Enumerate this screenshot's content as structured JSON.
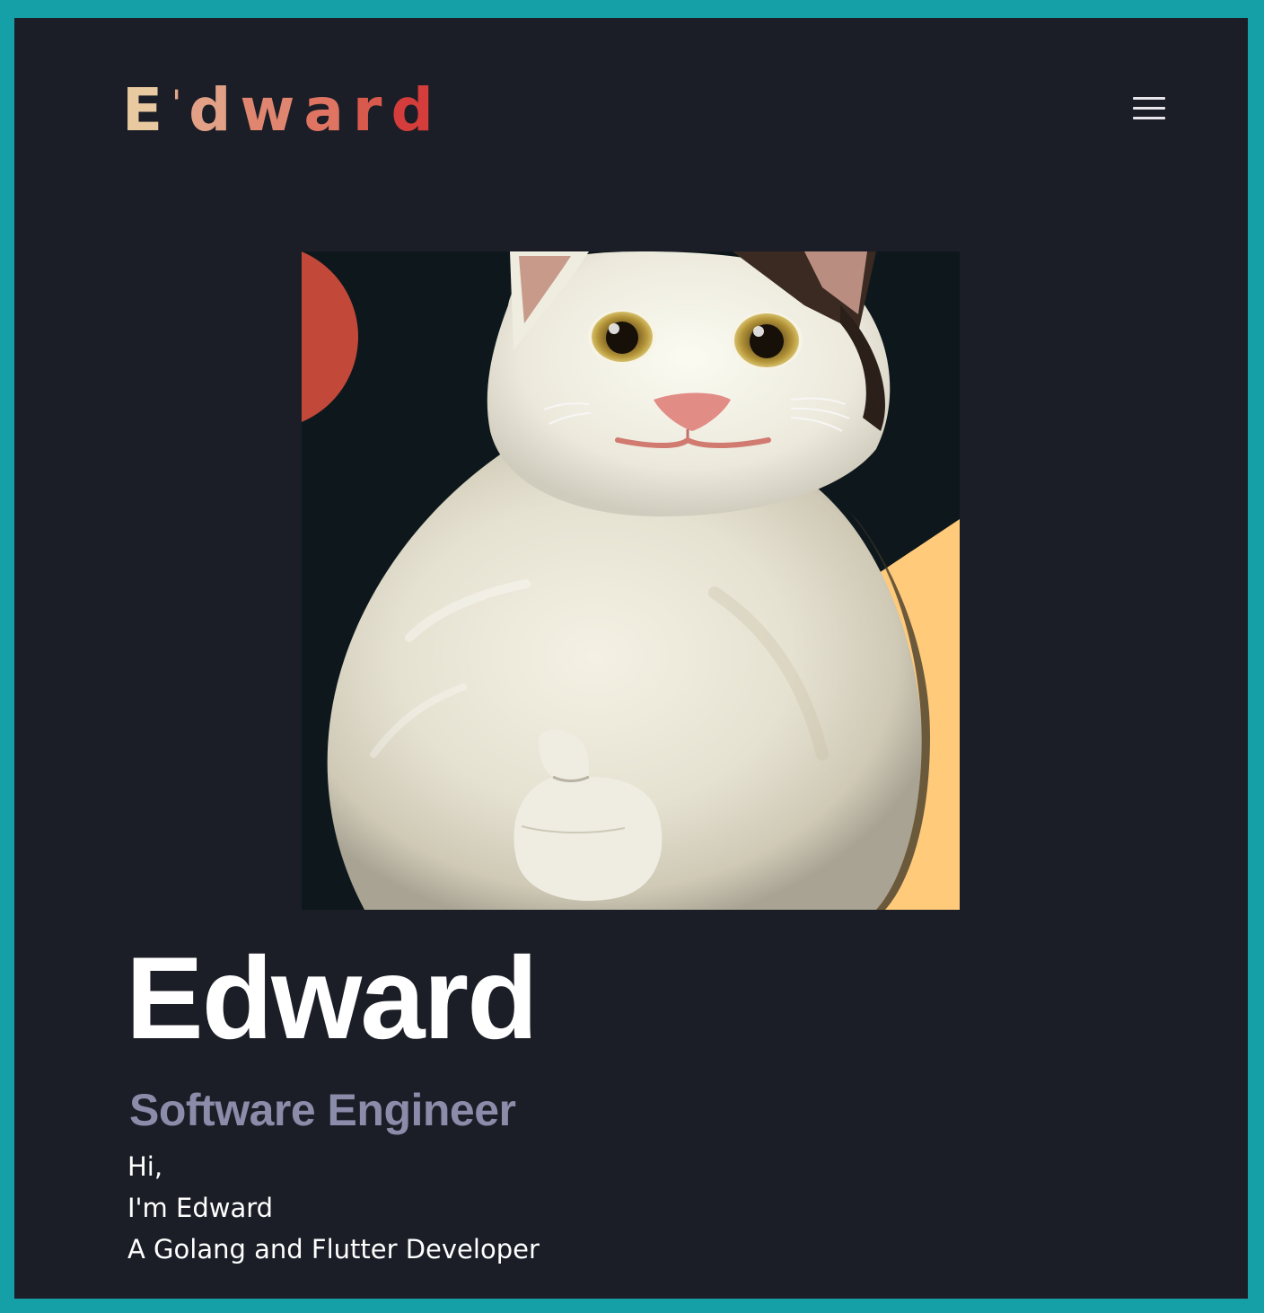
{
  "header": {
    "logo": {
      "text": "E'dward",
      "letters": [
        {
          "char": "E",
          "color": "#e8c9a0"
        },
        {
          "char": "'",
          "color": "#e3a68a"
        },
        {
          "char": "d",
          "color": "#e2a087"
        },
        {
          "char": "w",
          "color": "#e08670"
        },
        {
          "char": "a",
          "color": "#de7461"
        },
        {
          "char": "r",
          "color": "#d85a4c"
        },
        {
          "char": "d",
          "color": "#d43d3b"
        }
      ]
    },
    "menu_icon": "hamburger-menu-icon"
  },
  "hero_image": {
    "subject": "painted white cat with thumbs-up paw",
    "background_colors": {
      "dark": "#0e181c",
      "red_circle": "#c2493a",
      "yellow_band": "#ffca7a"
    }
  },
  "profile": {
    "name": "Edward",
    "role": "Software Engineer",
    "intro_lines": [
      "Hi,",
      "I'm Edward",
      "A Golang and Flutter Developer"
    ]
  },
  "colors": {
    "frame": "#14a0a6",
    "background": "#1b1e26",
    "name": "#ffffff",
    "role": "#8a8ca9",
    "intro": "#ffffff"
  }
}
